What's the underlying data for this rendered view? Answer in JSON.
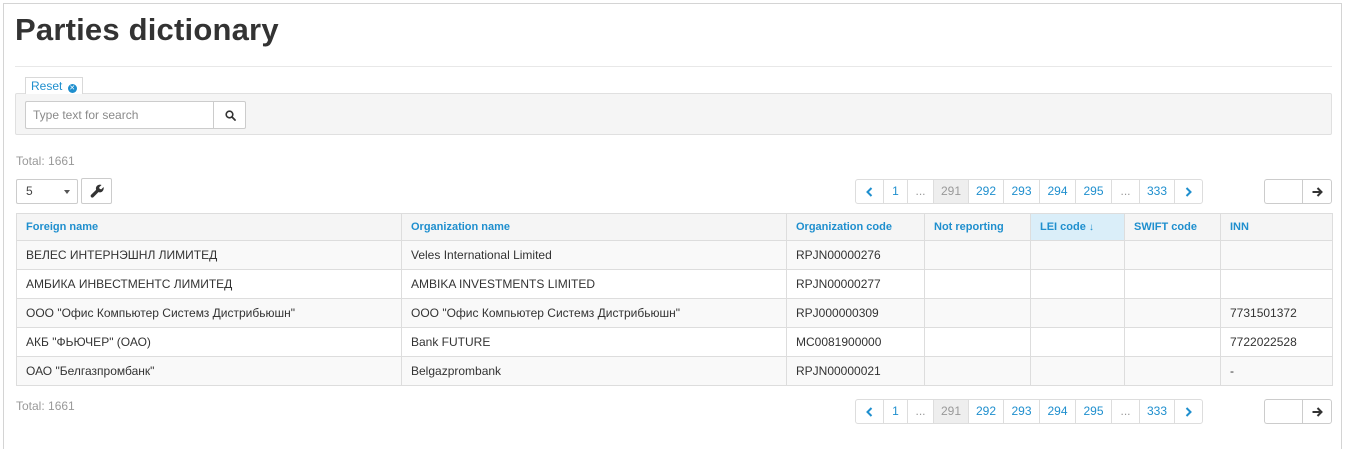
{
  "page": {
    "title": "Parties dictionary"
  },
  "filters": {
    "reset_label": "Reset"
  },
  "search": {
    "placeholder": "Type text for search"
  },
  "summary": {
    "total_top": "Total: 1661",
    "total_bottom": "Total: 1661"
  },
  "page_size": {
    "value": "5"
  },
  "pagination": {
    "prev": "‹",
    "next": "›",
    "pages": [
      "1",
      "...",
      "291",
      "292",
      "293",
      "294",
      "295",
      "...",
      "333"
    ],
    "active": "291"
  },
  "table": {
    "columns": [
      "Foreign name",
      "Organization name",
      "Organization code",
      "Not reporting",
      "LEI code",
      "SWIFT code",
      "INN"
    ],
    "sorted_column": "LEI code",
    "rows": [
      [
        "ВЕЛЕС ИНТЕРНЭШНЛ ЛИМИТЕД",
        "Veles International Limited",
        "RPJN00000276",
        "",
        "",
        "",
        ""
      ],
      [
        "АМБИКА ИНВЕСТМЕНТС ЛИМИТЕД",
        "AMBIKA INVESTMENTS LIMITED",
        "RPJN00000277",
        "",
        "",
        "",
        ""
      ],
      [
        "ООО \"Офис Компьютер Системз Дистрибьюшн\"",
        "ООО \"Офис Компьютер Системз Дистрибьюшн\"",
        "RPJ000000309",
        "",
        "",
        "",
        "7731501372"
      ],
      [
        "АКБ \"ФЬЮЧЕР\" (ОАО)",
        "Bank FUTURE",
        "MC0081900000",
        "",
        "",
        "",
        "7722022528"
      ],
      [
        "ОАО \"Белгазпромбанк\"",
        "Belgazprombank",
        "RPJN00000021",
        "",
        "",
        "",
        "-"
      ]
    ]
  },
  "colors": {
    "link": "#1f8fce",
    "sorted_header": "#daeef9",
    "header_bg": "#f5f5f5"
  }
}
